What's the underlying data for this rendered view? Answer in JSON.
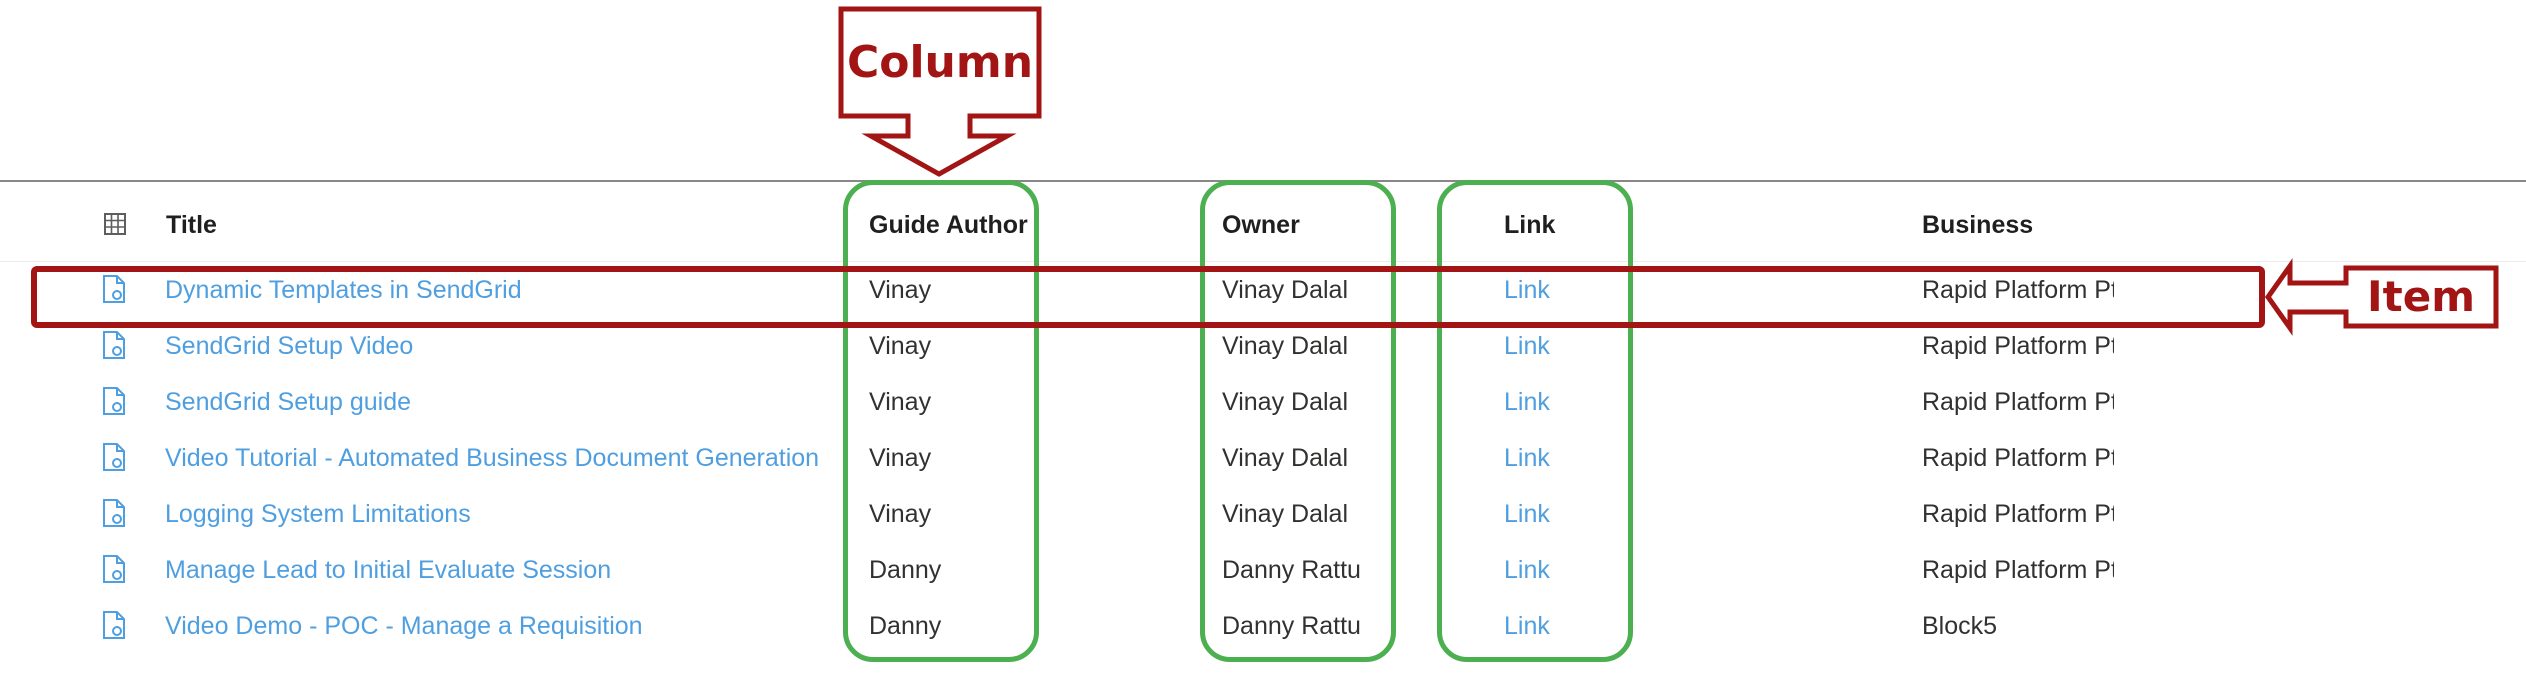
{
  "header": {
    "title": "Title",
    "guide_author": "Guide Author",
    "owner": "Owner",
    "link": "Link",
    "business": "Business",
    "grid_icon": "grid-icon"
  },
  "rows": [
    {
      "title": "Dynamic Templates in SendGrid",
      "author": "Vinay",
      "owner": "Vinay Dalal",
      "link": "Link",
      "business": "Rapid Platform Pty"
    },
    {
      "title": "SendGrid Setup Video",
      "author": "Vinay",
      "owner": "Vinay Dalal",
      "link": "Link",
      "business": "Rapid Platform Pty"
    },
    {
      "title": "SendGrid Setup guide",
      "author": "Vinay",
      "owner": "Vinay Dalal",
      "link": "Link",
      "business": "Rapid Platform Pty"
    },
    {
      "title": "Video Tutorial - Automated Business Document Generation",
      "author": "Vinay",
      "owner": "Vinay Dalal",
      "link": "Link",
      "business": "Rapid Platform Pty"
    },
    {
      "title": "Logging System Limitations",
      "author": "Vinay",
      "owner": "Vinay Dalal",
      "link": "Link",
      "business": "Rapid Platform Pty"
    },
    {
      "title": "Manage Lead to Initial Evaluate Session",
      "author": "Danny",
      "owner": "Danny Rattu",
      "link": "Link",
      "business": "Rapid Platform Pty"
    },
    {
      "title": "Video Demo - POC - Manage a Requisition",
      "author": "Danny",
      "owner": "Danny Rattu",
      "link": "Link",
      "business": "Block5"
    }
  ],
  "annotations": {
    "column_label": "Column",
    "item_label": "Item",
    "column_color": "#4caf50",
    "callout_color": "#a31515"
  },
  "colors": {
    "link": "#4f9fe0",
    "text": "#323130",
    "header_text": "#201f1e"
  }
}
